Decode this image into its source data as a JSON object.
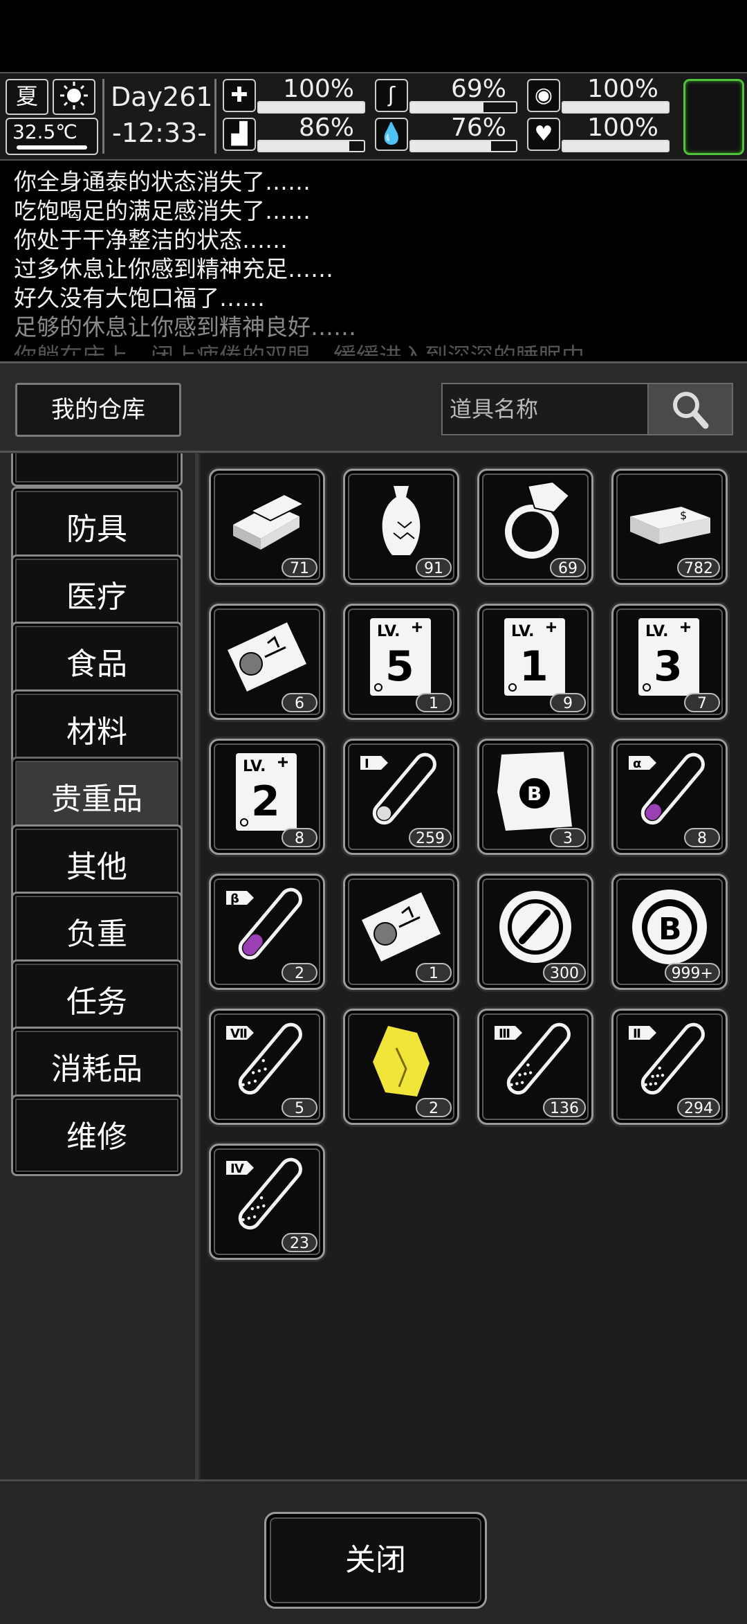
{
  "status": {
    "season": "夏",
    "temperature": "32.5℃",
    "day": "Day261",
    "clock": "-12:33-",
    "stats": [
      {
        "icon": "medkit-icon",
        "glyph": "✚",
        "value": "100%",
        "level": 1.0
      },
      {
        "icon": "stomach-icon",
        "glyph": "ʃ",
        "value": "69%",
        "level": 0.69
      },
      {
        "icon": "pill-icon",
        "glyph": "◉",
        "value": "100%",
        "level": 1.0
      },
      {
        "icon": "boot-icon",
        "glyph": "▟",
        "value": "86%",
        "level": 0.86
      },
      {
        "icon": "water-drop-icon",
        "glyph": "💧",
        "value": "76%",
        "level": 0.76
      },
      {
        "icon": "heart-icon",
        "glyph": "♥",
        "value": "100%",
        "level": 1.0
      }
    ]
  },
  "log": [
    "你全身通泰的状态消失了……",
    "吃饱喝足的满足感消失了……",
    "你处于干净整洁的状态……",
    "过多休息让你感到精神充足……",
    "好久没有大饱口福了……",
    "足够的休息让你感到精神良好……",
    "你躺在床上，闭上疲倦的双眼，缓缓进入到深深的睡眠中"
  ],
  "panel": {
    "title": "我的仓库",
    "search_placeholder": "道具名称"
  },
  "categories": [
    "防具",
    "医疗",
    "食品",
    "材料",
    "贵重品",
    "其他",
    "负重",
    "任务",
    "消耗品",
    "维修"
  ],
  "selected_category": "贵重品",
  "items": [
    {
      "name": "gold-bars-icon",
      "count": "71"
    },
    {
      "name": "vase-icon",
      "count": "91"
    },
    {
      "name": "ring-icon",
      "count": "69"
    },
    {
      "name": "cash-stack-icon",
      "count": "782"
    },
    {
      "name": "portrait-ticket-icon",
      "count": "6"
    },
    {
      "name": "skill-book-icon",
      "count": "1",
      "level": "5"
    },
    {
      "name": "skill-book-icon",
      "count": "9",
      "level": "1"
    },
    {
      "name": "skill-book-icon",
      "count": "7",
      "level": "3"
    },
    {
      "name": "skill-book-icon",
      "count": "8",
      "level": "2"
    },
    {
      "name": "test-tube-icon",
      "count": "259",
      "tag": "I",
      "fill": 0.18,
      "liquid": "#ddd"
    },
    {
      "name": "bounty-map-icon",
      "count": "3"
    },
    {
      "name": "test-tube-icon",
      "count": "8",
      "tag": "α",
      "fill": 0.22,
      "liquid": "#9b3fb5"
    },
    {
      "name": "test-tube-icon",
      "count": "2",
      "tag": "β",
      "fill": 0.3,
      "liquid": "#9b3fb5"
    },
    {
      "name": "portrait-ticket-icon",
      "count": "1"
    },
    {
      "name": "wrench-coin-icon",
      "count": "300"
    },
    {
      "name": "b-coin-icon",
      "count": "999+"
    },
    {
      "name": "test-tube-icon",
      "count": "5",
      "tag": "Ⅶ",
      "fill": 0.55,
      "liquid": "dots"
    },
    {
      "name": "gold-nugget-icon",
      "count": "2"
    },
    {
      "name": "test-tube-icon",
      "count": "136",
      "tag": "Ⅲ",
      "fill": 0.45,
      "liquid": "dots"
    },
    {
      "name": "test-tube-icon",
      "count": "294",
      "tag": "Ⅱ",
      "fill": 0.38,
      "liquid": "dots"
    },
    {
      "name": "test-tube-icon",
      "count": "23",
      "tag": "Ⅳ",
      "fill": 0.5,
      "liquid": "dots"
    }
  ],
  "footer": {
    "close_label": "关闭"
  }
}
